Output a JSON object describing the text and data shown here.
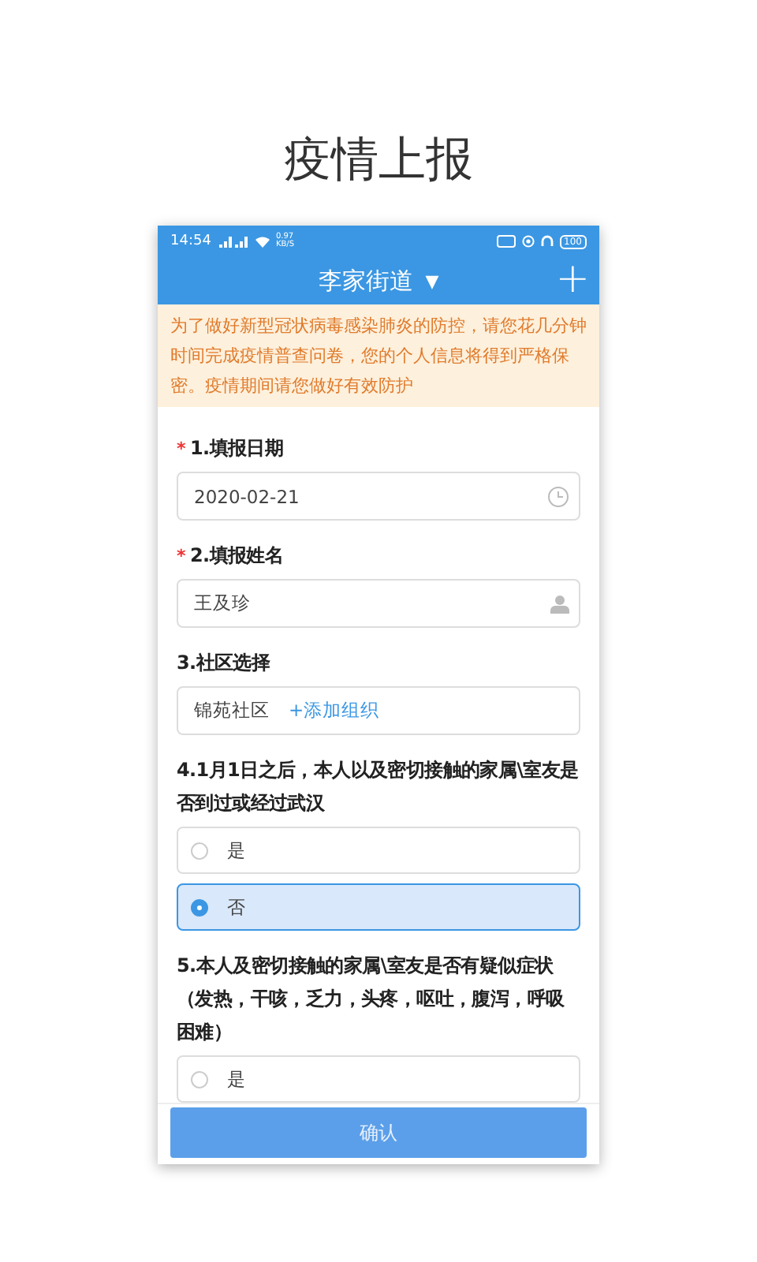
{
  "page_title": "疫情上报",
  "status_bar": {
    "time": "14:54",
    "speed": "0.97",
    "speed_unit": "KB/S",
    "battery": "100"
  },
  "header": {
    "title": "李家街道",
    "caret": "▼",
    "add": "+"
  },
  "notice": "为了做好新型冠状病毒感染肺炎的防控，请您花几分钟时间完成疫情普查问卷，您的个人信息将得到严格保密。疫情期间请您做好有效防护",
  "questions": [
    {
      "kind": "date",
      "label": "1.填报日期",
      "marker": "*",
      "value": "2020-02-21"
    },
    {
      "kind": "name",
      "label": "2.填报姓名",
      "marker": "*",
      "value": "王及珍"
    },
    {
      "kind": "community",
      "label": "3.社区选择",
      "value": "锦苑社区",
      "link": "+添加组织"
    },
    {
      "kind": "radio",
      "label": "4.1月1日之后，本人以及密切接触的家属\\室友是否到过或经过武汉",
      "options": [
        {
          "label": "是",
          "selected": false
        },
        {
          "label": "否",
          "selected": true
        }
      ]
    },
    {
      "kind": "radio",
      "label": "5.本人及密切接触的家属\\室友是否有疑似症状（发热，干咳，乏力，头疼，呕吐，腹泻，呼吸困难）",
      "options": [
        {
          "label": "是"
        }
      ]
    }
  ],
  "confirm_button": "确认"
}
